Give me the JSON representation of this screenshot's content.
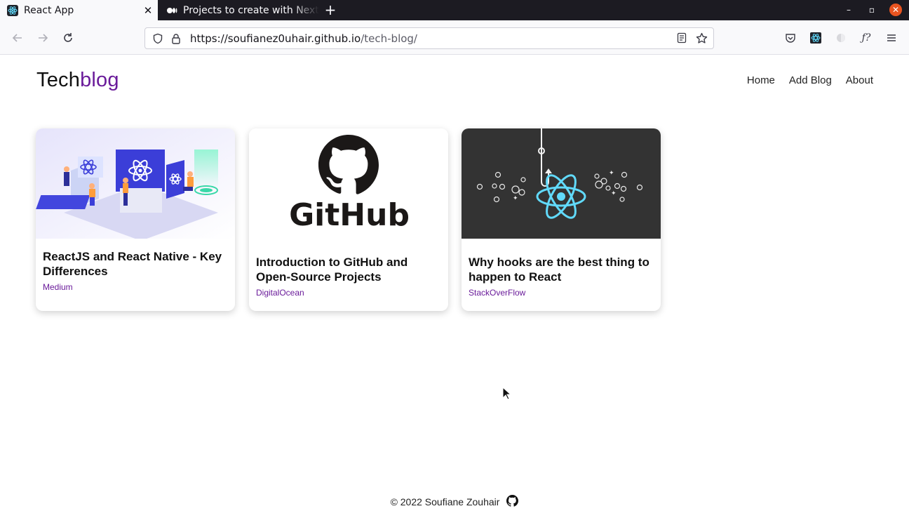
{
  "browser": {
    "tabs": [
      {
        "title": "React App",
        "favicon": "react-icon",
        "active": true
      },
      {
        "title": "Projects to create with Next",
        "favicon": "medium-icon",
        "active": false
      }
    ],
    "url_host": "https://soufianez0uhair.github.io",
    "url_path": "/tech-blog/"
  },
  "header": {
    "brand_prefix": "Tech",
    "brand_suffix": "blog",
    "nav": [
      "Home",
      "Add Blog",
      "About"
    ]
  },
  "posts": [
    {
      "title": "ReactJS and React Native - Key Differences",
      "source": "Medium",
      "image": "react-illustration"
    },
    {
      "title": "Introduction to GitHub and Open-Source Projects",
      "source": "DigitalOcean",
      "image": "github-logo",
      "image_text": "GitHub"
    },
    {
      "title": "Why hooks are the best thing to happen to React",
      "source": "StackOverFlow",
      "image": "react-hook-illustration"
    }
  ],
  "footer": {
    "text": "© 2022 Soufiane Zouhair",
    "icon": "github-icon"
  },
  "colors": {
    "accent": "#6a1b9a",
    "tabbar": "#1c1b22",
    "react_blue": "#61dafb"
  }
}
